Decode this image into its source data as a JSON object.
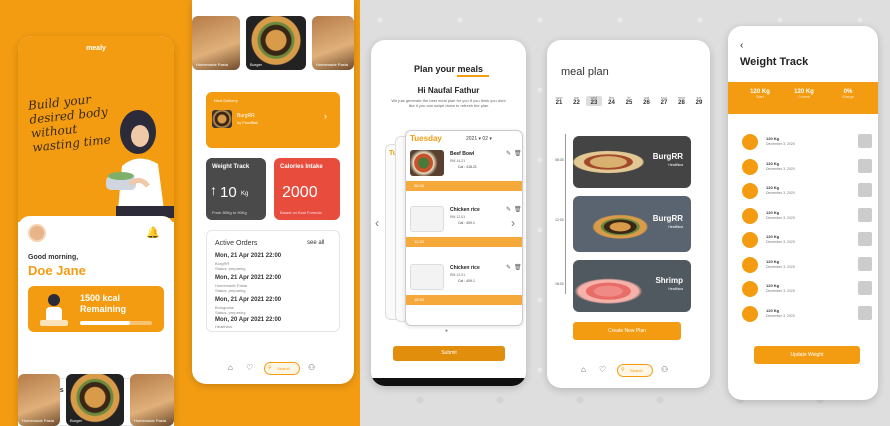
{
  "colors": {
    "accent": "#f39c12",
    "danger": "#e74c3c",
    "dark": "#4a4a4a"
  },
  "home": {
    "logo": "mealy",
    "slogan": "Build your desired body without wasting time",
    "greeting": "Good morning,",
    "user_name": "Doe Jane",
    "kcal_line1": "1500 kcal",
    "kcal_line2": "Remaining",
    "kcal_progress": 0.7,
    "menu_title": "Today's Menu",
    "see_all": "see all",
    "menu_items": [
      "Homemade Pasta",
      "Burger",
      "Homemade Pasta"
    ]
  },
  "dashboard": {
    "top_items": [
      "Homemade Pasta",
      "Burger",
      "Homemade Pasta"
    ],
    "next_delivery_label": "Next Delivery",
    "next_delivery_name": "BurgRR",
    "next_delivery_by": "by FoodBall",
    "weight_title": "Weight Track",
    "weight_value": "10",
    "weight_unit": "Kg",
    "weight_sub": "From 80Kg to 90Kg",
    "calories_title": "Calories Intake",
    "calories_value": "2000",
    "calories_sub": "Based on Kcal Formula",
    "orders_title": "Active Orders",
    "orders_see_all": "see all",
    "orders": [
      {
        "date": "Mon, 21 Apr 2021 22:00",
        "meal": "BurgRR",
        "status": "Status: preparing"
      },
      {
        "date": "Mon, 21 Apr 2021 22:00",
        "meal": "Homemade Pasta",
        "status": "Status: preparing"
      },
      {
        "date": "Mon, 21 Apr 2021 22:00",
        "meal": "Bolognese",
        "status": "Status: preparing"
      },
      {
        "date": "Mon, 20 Apr 2021 22:00",
        "meal": "Healthica",
        "status": "Status: Unprepared"
      }
    ],
    "search_label": "Search"
  },
  "plan": {
    "title": "Plan your meals",
    "hi": "Hi Naufal Fathur",
    "desc": "We just generate the best meal plan for you If you think you dont like it you can swipe down to refresh the plan",
    "day": "Tuesday",
    "date": "2021  ▾  02  ▾",
    "back_day": "Tue",
    "times": [
      "08:30",
      "12:30",
      "18:30"
    ],
    "meals": [
      {
        "name": "Beef Bowl",
        "price": "RM 14.21",
        "cal": "Cal : 418.21"
      },
      {
        "name": "Chicken rice",
        "price": "RM 12.01",
        "cal": "Cal : 409.1"
      },
      {
        "name": "Chicken rice",
        "price": "RM 12.01",
        "cal": "Cal : 409.1"
      }
    ],
    "submit": "Submit"
  },
  "meal_plan": {
    "title": "meal plan",
    "days": [
      {
        "n": "mon",
        "d": "21"
      },
      {
        "n": "tue",
        "d": "22"
      },
      {
        "n": "wed",
        "d": "23"
      },
      {
        "n": "thu",
        "d": "24"
      },
      {
        "n": "fri",
        "d": "25"
      },
      {
        "n": "sat",
        "d": "26"
      },
      {
        "n": "sun",
        "d": "27"
      },
      {
        "n": "mon",
        "d": "28"
      },
      {
        "n": "tue",
        "d": "29"
      }
    ],
    "selected_day": 2,
    "times": [
      "08:30",
      "12:00",
      "18:00"
    ],
    "cards": [
      {
        "name": "BurgRR",
        "sub": "Healthica"
      },
      {
        "name": "BurgRR",
        "sub": "Healthica"
      },
      {
        "name": "Shrimp",
        "sub": "Healthica"
      }
    ],
    "create": "Create New Plan"
  },
  "weight": {
    "back": "‹",
    "title": "Weight Track",
    "stats": [
      {
        "value": "120 Kg",
        "label": "Start"
      },
      {
        "value": "120 Kg",
        "label": "Current"
      },
      {
        "value": "0%",
        "label": "Change"
      }
    ],
    "entry_value": "120 Kg",
    "entry_date": "December 3, 2020",
    "update": "Update Weight"
  }
}
